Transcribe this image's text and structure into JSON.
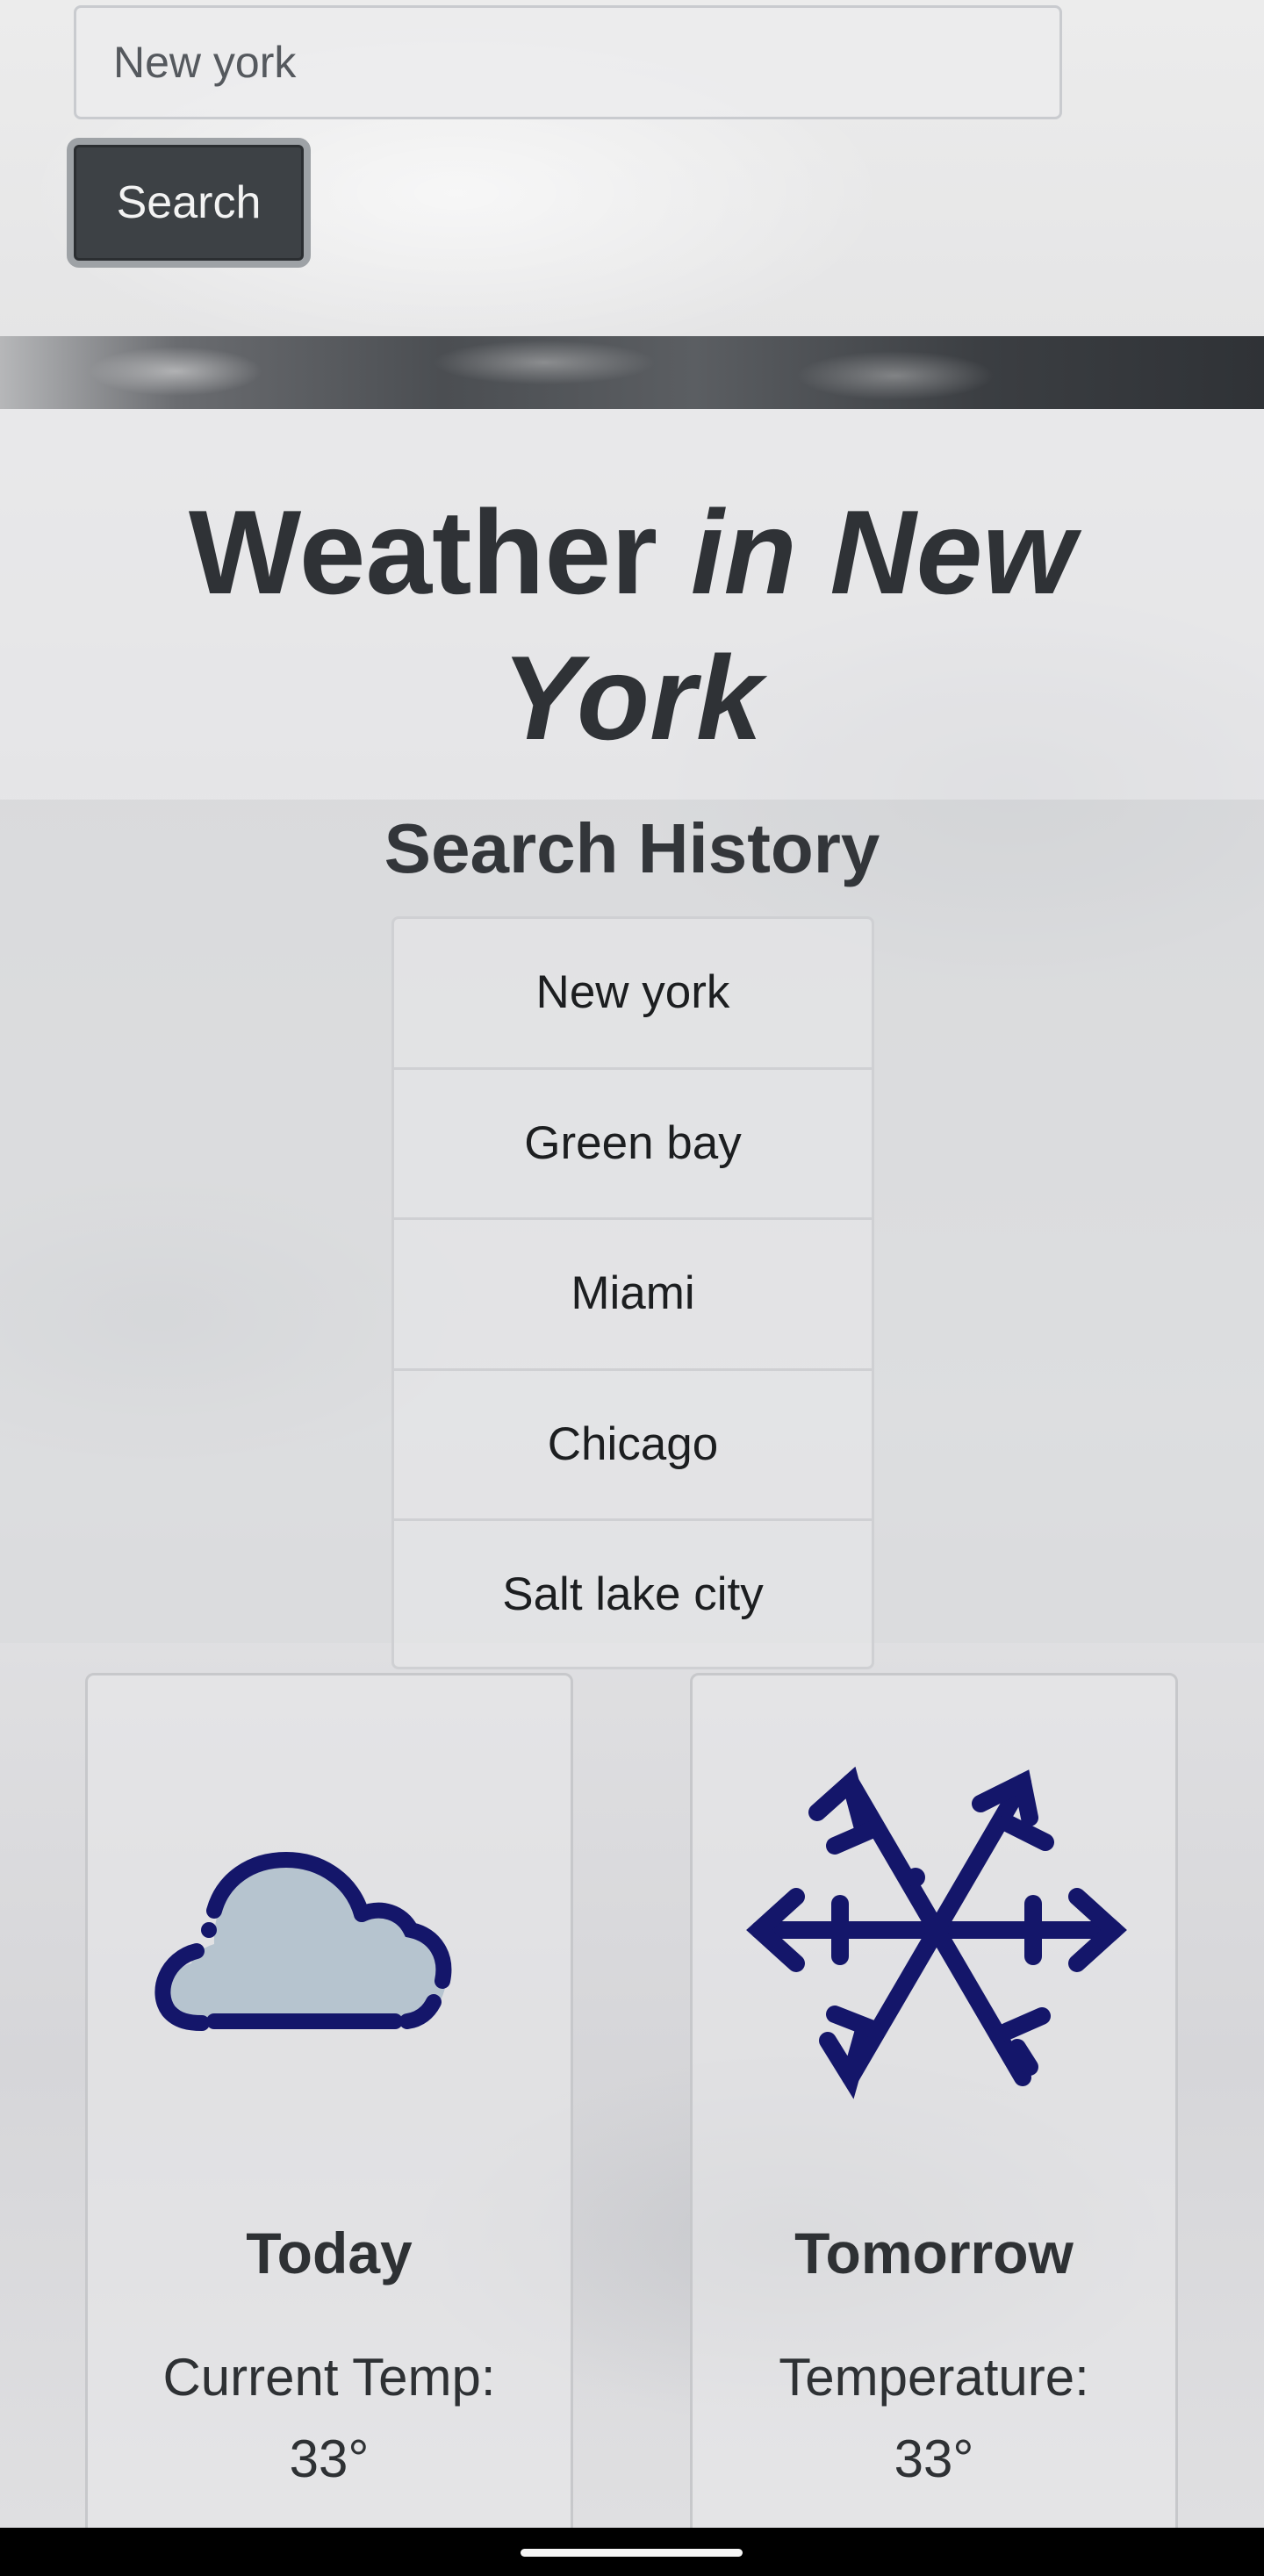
{
  "search": {
    "value": "New york",
    "button_label": "Search"
  },
  "title": {
    "prefix": "Weather ",
    "city_line1": "in New",
    "city_line2": "York"
  },
  "history": {
    "heading": "Search History",
    "items": [
      "New york",
      "Green bay",
      "Miami",
      "Chicago",
      "Salt lake city"
    ]
  },
  "forecast": {
    "today": {
      "icon": "cloud-icon",
      "title": "Today",
      "temp_label": "Current Temp:",
      "temp_value": "33°"
    },
    "tomorrow": {
      "icon": "snowflake-icon",
      "title": "Tomorrow",
      "temp_label": "Temperature:",
      "temp_value": "33°"
    }
  },
  "colors": {
    "icon_stroke": "#14166a",
    "cloud_fill": "#b6c4cf",
    "button_bg": "#3d4145"
  }
}
